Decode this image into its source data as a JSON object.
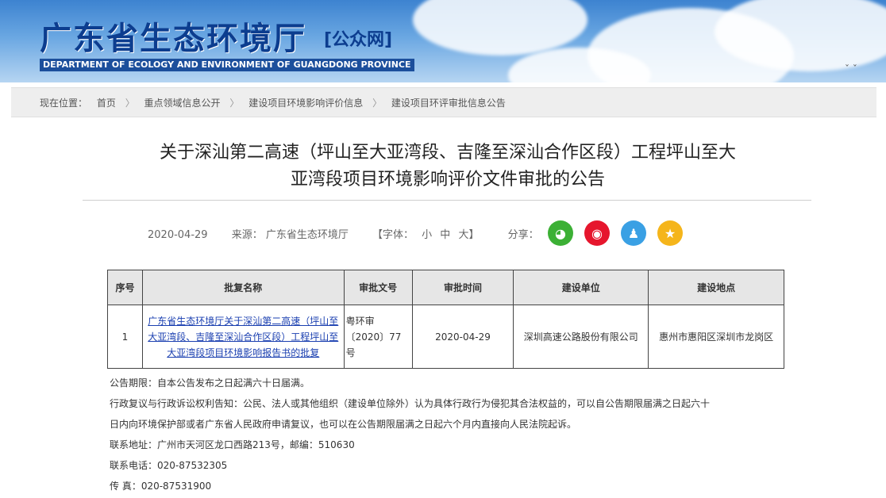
{
  "header": {
    "title": "广东省生态环境厅",
    "tag": "[公众网]",
    "subtitle": "DEPARTMENT OF ECOLOGY AND ENVIRONMENT OF GUANGDONG PROVINCE"
  },
  "breadcrumb": {
    "prefix": "现在位置：",
    "items": [
      "首页",
      "重点领域信息公开",
      "建设项目环境影响评价信息",
      "建设项目环评审批信息公告"
    ],
    "separator": "〉"
  },
  "article": {
    "title_line1": "关于深汕第二高速（坪山至大亚湾段、吉隆至深汕合作区段）工程坪山至大",
    "title_line2": "亚湾段项目环境影响评价文件审批的公告",
    "date": "2020-04-29",
    "source": "来源：  广东省生态环境厅",
    "font_label": "【字体：",
    "font_small": "小",
    "font_medium": "中",
    "font_large": "大】",
    "share_label": "分享："
  },
  "share_icons": [
    "wechat-icon",
    "weibo-icon",
    "qq-icon",
    "qzone-icon"
  ],
  "table": {
    "headers": [
      "序号",
      "批复名称",
      "审批文号",
      "审批时间",
      "建设单位",
      "建设地点"
    ],
    "row": {
      "index": "1",
      "name": "广东省生态环境厅关于深汕第二高速（坪山至大亚湾段、吉隆至深汕合作区段）工程坪山至大亚湾段项目环境影响报告书的批复",
      "doc_no": "粤环审〔2020〕77号",
      "date": "2020-04-29",
      "unit": "深圳高速公路股份有限公司",
      "location": "惠州市惠阳区深圳市龙岗区"
    }
  },
  "notes": {
    "period": "公告期限：自本公告发布之日起满六十日届满。",
    "review_line1": "行政复议与行政诉讼权利告知：公民、法人或其他组织（建设单位除外）认为具体行政行为侵犯其合法权益的，可以自公告期限届满之日起六十",
    "review_line2": "日内向环境保护部或者广东省人民政府申请复议，也可以在公告期限届满之日起六个月内直接向人民法院起诉。",
    "address": "联系地址：广州市天河区龙口西路213号，邮编：510630",
    "phone": "联系电话：020-87532305",
    "fax": "传      真：020-87531900"
  },
  "colors": {
    "banner_top": "#3d83d0",
    "title_blue": "#0c3d8f",
    "link_blue": "#1a3fb0",
    "wechat": "#3cb035",
    "weibo": "#e6162d",
    "qq": "#3aa0e4",
    "qzone": "#f5b51b"
  }
}
